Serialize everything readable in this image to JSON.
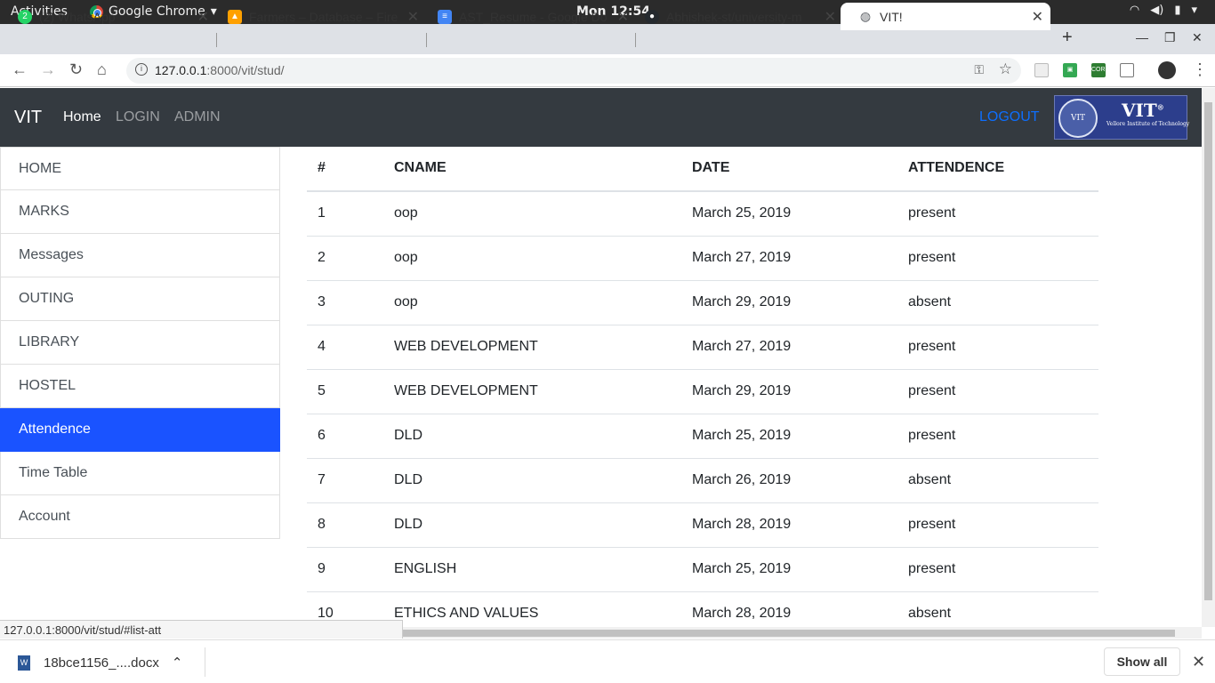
{
  "system": {
    "activities": "Activities",
    "app_name": "Google Chrome",
    "clock": "Mon 12:54"
  },
  "tabs": [
    {
      "title": "(2) WhatsApp",
      "badge": "2",
      "color": "#25d366"
    },
    {
      "title": "Farmers – Database – Fire",
      "color": "#ffa000"
    },
    {
      "title": "AST_Resume - Google Do",
      "color": "#4285f4"
    },
    {
      "title": "Abhishek-st/university-m",
      "color": "#24292e"
    },
    {
      "title": "VIT!",
      "color": "#5f6368"
    }
  ],
  "omnibox": {
    "host": "127.0.0.1",
    "path": ":8000/vit/stud/"
  },
  "navbar": {
    "brand": "VIT",
    "links": [
      "Home",
      "LOGIN",
      "ADMIN"
    ],
    "logout": "LOGOUT",
    "logo_text": "VIT",
    "logo_reg": "®",
    "logo_seal": "VIT",
    "logo_sub": "Vellore Institute of Technology"
  },
  "sidebar": {
    "items": [
      "HOME",
      "MARKS",
      "Messages",
      "OUTING",
      "LIBRARY",
      "HOSTEL",
      "Attendence",
      "Time Table",
      "Account"
    ],
    "active": "Attendence",
    "active_color": "#1a53ff"
  },
  "table": {
    "headers": [
      "#",
      "CNAME",
      "DATE",
      "ATTENDENCE"
    ],
    "rows": [
      [
        "1",
        "oop",
        "March 25, 2019",
        "present"
      ],
      [
        "2",
        "oop",
        "March 27, 2019",
        "present"
      ],
      [
        "3",
        "oop",
        "March 29, 2019",
        "absent"
      ],
      [
        "4",
        "WEB DEVELOPMENT",
        "March 27, 2019",
        "present"
      ],
      [
        "5",
        "WEB DEVELOPMENT",
        "March 29, 2019",
        "present"
      ],
      [
        "6",
        "DLD",
        "March 25, 2019",
        "present"
      ],
      [
        "7",
        "DLD",
        "March 26, 2019",
        "absent"
      ],
      [
        "8",
        "DLD",
        "March 28, 2019",
        "present"
      ],
      [
        "9",
        "ENGLISH",
        "March 25, 2019",
        "present"
      ],
      [
        "10",
        "ETHICS AND VALUES",
        "March 28, 2019",
        "absent"
      ]
    ]
  },
  "status_url": "127.0.0.1:8000/vit/stud/#list-att",
  "downloads": {
    "file": "18bce1156_....docx",
    "show_all": "Show all"
  }
}
